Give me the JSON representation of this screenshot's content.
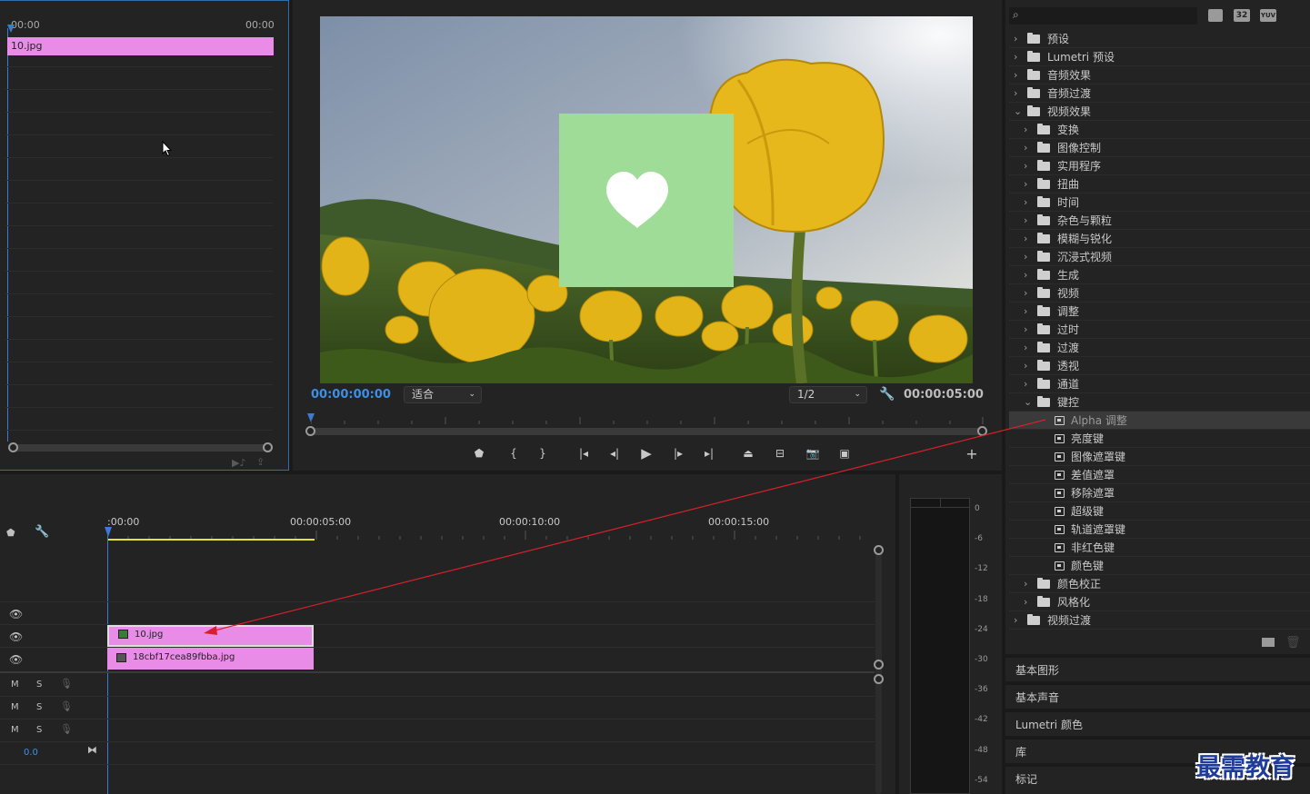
{
  "effect_controls": {
    "tc_start": "00:00",
    "tc_end": "00:00",
    "clip_name": "10.jpg"
  },
  "program": {
    "timecode_current": "00:00:00:00",
    "fit_label": "适合",
    "resolution": "1/2",
    "timecode_duration": "00:00:05:00"
  },
  "effects": {
    "search_placeholder": "",
    "badges": [
      "32",
      "YUV"
    ],
    "tree": [
      {
        "label": "预设",
        "indent": 0,
        "type": "folder-special",
        "open": false
      },
      {
        "label": "Lumetri 预设",
        "indent": 0,
        "type": "folder-special",
        "open": false
      },
      {
        "label": "音频效果",
        "indent": 0,
        "type": "folder",
        "open": false
      },
      {
        "label": "音频过渡",
        "indent": 0,
        "type": "folder",
        "open": false
      },
      {
        "label": "视频效果",
        "indent": 0,
        "type": "folder",
        "open": true
      },
      {
        "label": "变换",
        "indent": 1,
        "type": "folder",
        "open": false
      },
      {
        "label": "图像控制",
        "indent": 1,
        "type": "folder",
        "open": false
      },
      {
        "label": "实用程序",
        "indent": 1,
        "type": "folder",
        "open": false
      },
      {
        "label": "扭曲",
        "indent": 1,
        "type": "folder",
        "open": false
      },
      {
        "label": "时间",
        "indent": 1,
        "type": "folder",
        "open": false
      },
      {
        "label": "杂色与颗粒",
        "indent": 1,
        "type": "folder",
        "open": false
      },
      {
        "label": "模糊与锐化",
        "indent": 1,
        "type": "folder",
        "open": false
      },
      {
        "label": "沉浸式视频",
        "indent": 1,
        "type": "folder",
        "open": false
      },
      {
        "label": "生成",
        "indent": 1,
        "type": "folder",
        "open": false
      },
      {
        "label": "视频",
        "indent": 1,
        "type": "folder",
        "open": false
      },
      {
        "label": "调整",
        "indent": 1,
        "type": "folder",
        "open": false
      },
      {
        "label": "过时",
        "indent": 1,
        "type": "folder",
        "open": false
      },
      {
        "label": "过渡",
        "indent": 1,
        "type": "folder",
        "open": false
      },
      {
        "label": "透视",
        "indent": 1,
        "type": "folder",
        "open": false
      },
      {
        "label": "通道",
        "indent": 1,
        "type": "folder",
        "open": false
      },
      {
        "label": "键控",
        "indent": 1,
        "type": "folder",
        "open": true
      },
      {
        "label": "Alpha 调整",
        "indent": 2,
        "type": "effect",
        "selected": true
      },
      {
        "label": "亮度键",
        "indent": 2,
        "type": "effect"
      },
      {
        "label": "图像遮罩键",
        "indent": 2,
        "type": "effect"
      },
      {
        "label": "差值遮罩",
        "indent": 2,
        "type": "effect"
      },
      {
        "label": "移除遮罩",
        "indent": 2,
        "type": "effect"
      },
      {
        "label": "超级键",
        "indent": 2,
        "type": "effect"
      },
      {
        "label": "轨道遮罩键",
        "indent": 2,
        "type": "effect"
      },
      {
        "label": "非红色键",
        "indent": 2,
        "type": "effect"
      },
      {
        "label": "颜色键",
        "indent": 2,
        "type": "effect"
      },
      {
        "label": "颜色校正",
        "indent": 1,
        "type": "folder",
        "open": false
      },
      {
        "label": "风格化",
        "indent": 1,
        "type": "folder",
        "open": false
      },
      {
        "label": "视频过渡",
        "indent": 0,
        "type": "folder",
        "open": false
      }
    ]
  },
  "panels": {
    "essential_graphics": "基本图形",
    "essential_sound": "基本声音",
    "lumetri_color": "Lumetri 颜色",
    "library": "库",
    "markers": "标记"
  },
  "timeline": {
    "ruler": [
      ":00:00",
      "00:00:05:00",
      "00:00:10:00",
      "00:00:15:00"
    ],
    "clip_v2": "10.jpg",
    "clip_v1": "18cbf17cea89fbba.jpg",
    "audio_label_m": "M",
    "audio_label_s": "S",
    "volume": "0.0"
  },
  "meter": {
    "db_labels": [
      "0",
      "-6",
      "-12",
      "-18",
      "-24",
      "-30",
      "-36",
      "-42",
      "-48",
      "-54"
    ]
  },
  "watermark": "最需教育"
}
